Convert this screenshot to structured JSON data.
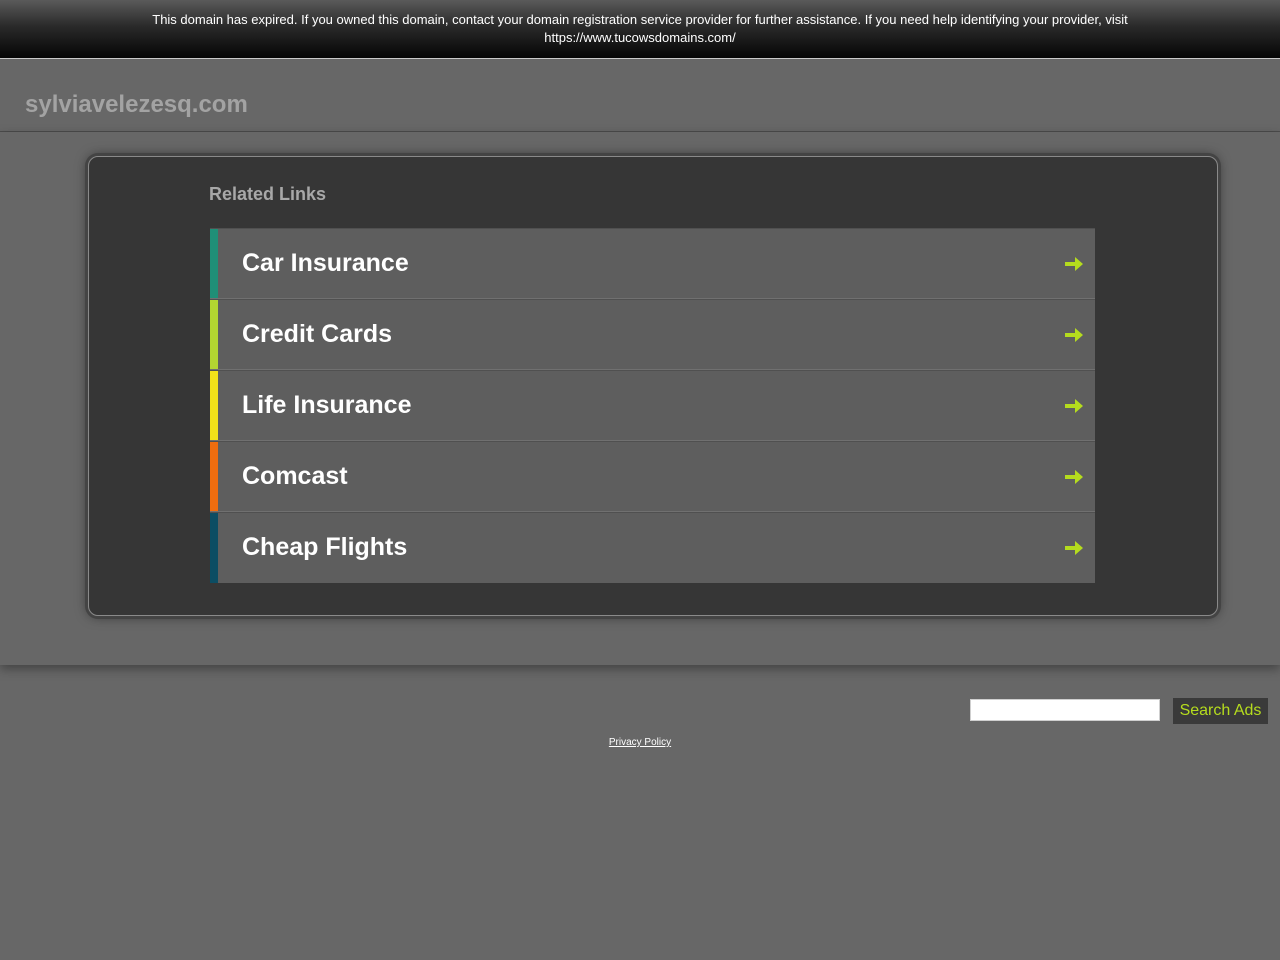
{
  "notice": {
    "line1": "This domain has expired. If you owned this domain, contact your domain registration service provider for further assistance. If you need help identifying your provider, visit",
    "line2": "https://www.tucowsdomains.com/"
  },
  "header": {
    "domain": "sylviavelezesq.com"
  },
  "related": {
    "title": "Related Links",
    "items": [
      {
        "label": "Car Insurance",
        "accent": "#1f8f77"
      },
      {
        "label": "Credit Cards",
        "accent": "#b3d531"
      },
      {
        "label": "Life Insurance",
        "accent": "#f2e21a"
      },
      {
        "label": "Comcast",
        "accent": "#ef6d0f"
      },
      {
        "label": "Cheap Flights",
        "accent": "#0c4d63"
      }
    ],
    "arrow_icon": "arrow-right-icon",
    "arrow_color": "#b5dc1e"
  },
  "search": {
    "input_value": "",
    "button_label": "Search Ads"
  },
  "footer": {
    "privacy_label": "Privacy Policy"
  }
}
